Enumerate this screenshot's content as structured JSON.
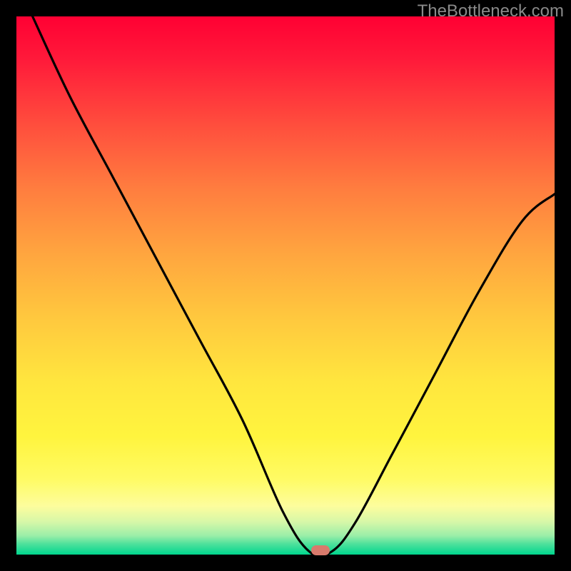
{
  "watermark": "TheBottleneck.com",
  "marker": {
    "cx_frac": 0.565,
    "cy_frac": 0.992
  },
  "chart_data": {
    "type": "line",
    "title": "",
    "xlabel": "",
    "ylabel": "",
    "xlim": [
      0,
      1
    ],
    "ylim": [
      0,
      1
    ],
    "grid": false,
    "series": [
      {
        "name": "bottleneck-curve",
        "x": [
          0.03,
          0.1,
          0.18,
          0.26,
          0.34,
          0.42,
          0.495,
          0.545,
          0.585,
          0.63,
          0.7,
          0.78,
          0.86,
          0.94,
          1.0
        ],
        "y": [
          1.0,
          0.85,
          0.7,
          0.55,
          0.4,
          0.25,
          0.08,
          0.005,
          0.005,
          0.06,
          0.19,
          0.34,
          0.49,
          0.62,
          0.67
        ]
      }
    ],
    "annotations": [
      {
        "type": "marker",
        "x": 0.565,
        "y": 0.008,
        "label": "optimal-point"
      }
    ],
    "background": {
      "type": "vertical-gradient",
      "stops": [
        {
          "pos": 0.0,
          "color": "#ff0033"
        },
        {
          "pos": 0.5,
          "color": "#ffcc3e"
        },
        {
          "pos": 0.9,
          "color": "#fffb64"
        },
        {
          "pos": 1.0,
          "color": "#00d68e"
        }
      ]
    }
  }
}
